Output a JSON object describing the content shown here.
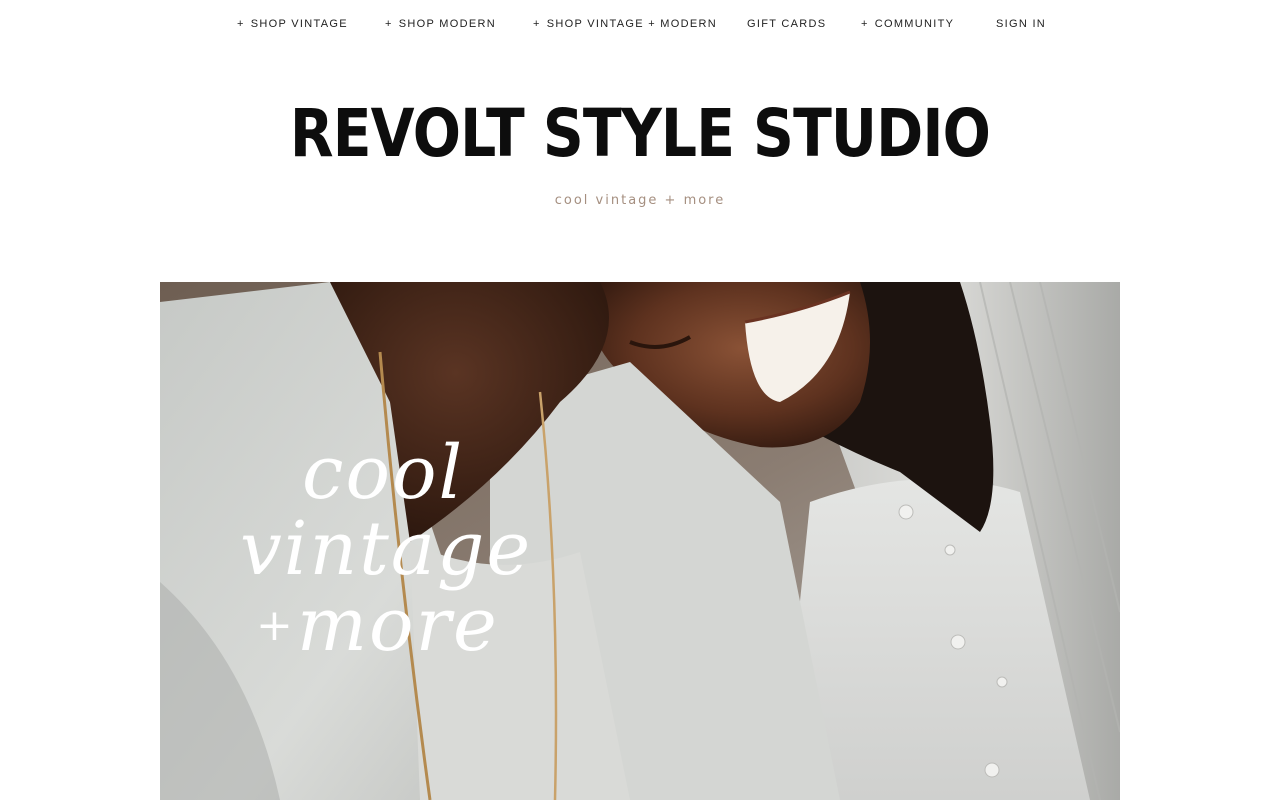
{
  "nav": {
    "items": [
      {
        "plus": "+",
        "label": "SHOP VINTAGE"
      },
      {
        "plus": "+",
        "label": "SHOP MODERN"
      },
      {
        "plus": "+",
        "label": "SHOP VINTAGE + MODERN"
      },
      {
        "plus": "",
        "label": "GIFT CARDS"
      },
      {
        "plus": "+",
        "label": "COMMUNITY"
      },
      {
        "plus": "",
        "label": "SIGN IN"
      }
    ]
  },
  "brand": {
    "title": "REVOLT STYLE STUDIO",
    "tagline": "cool vintage + more"
  },
  "hero": {
    "line1": "cool",
    "line2": "vintage",
    "line3_plus": "+",
    "line3_word": "more"
  },
  "colors": {
    "tagline": "#a58f80",
    "nav_text": "#1f1f1f",
    "brand_text": "#0d0d0d"
  }
}
